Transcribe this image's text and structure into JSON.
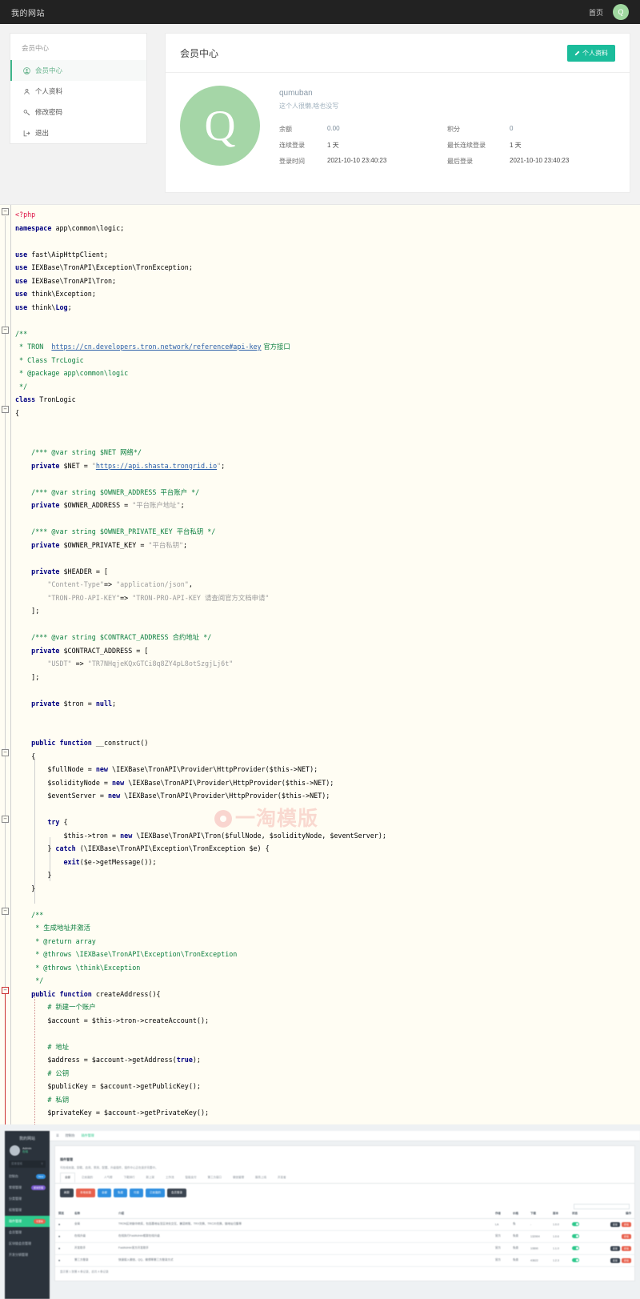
{
  "navbar": {
    "brand": "我的网站",
    "home_link": "首页",
    "avatar_letter": "Q"
  },
  "sidebar": {
    "title": "会员中心",
    "items": [
      {
        "label": "会员中心",
        "icon": "user-circle-icon",
        "active": true
      },
      {
        "label": "个人资料",
        "icon": "user-outline-icon",
        "active": false
      },
      {
        "label": "修改密码",
        "icon": "key-icon",
        "active": false
      },
      {
        "label": "退出",
        "icon": "logout-icon",
        "active": false
      }
    ]
  },
  "member_card": {
    "title": "会员中心",
    "profile_button": "个人资料",
    "avatar_letter": "Q",
    "username": "qumuban",
    "signature": "这个人很懒,啥也没写",
    "stats": [
      {
        "key": "余额",
        "value": "0.00",
        "key2": "积分",
        "value2": "0"
      },
      {
        "key": "连续登录",
        "value": "1 天",
        "key2": "最长连续登录",
        "value2": "1 天"
      },
      {
        "key": "登录时间",
        "value": "2021-10-10 23:40:23",
        "key2": "最后登录",
        "value2": "2021-10-10 23:40:23"
      }
    ]
  },
  "code": {
    "watermark": "一淘模版",
    "lines": [
      "<?php",
      "namespace app\\common\\logic;",
      "",
      "use fast\\AipHttpClient;",
      "use IEXBase\\TronAPI\\Exception\\TronException;",
      "use IEXBase\\TronAPI\\Tron;",
      "use think\\Exception;",
      "use think\\Log;",
      "",
      "/**",
      " * TRON  https://cn.developers.tron.network/reference#api-key 官方接口",
      " * Class TrcLogic",
      " * @package app\\common\\logic",
      " */",
      "class TronLogic",
      "{",
      "",
      "",
      "    /*** @var string $NET 网络*/",
      "    private $NET = \"https://api.shasta.trongrid.io\";",
      "",
      "    /*** @var string $OWNER_ADDRESS 平台账户 */",
      "    private $OWNER_ADDRESS = \"平台账户地址\";",
      "",
      "    /*** @var string $OWNER_PRIVATE_KEY 平台私钥 */",
      "    private $OWNER_PRIVATE_KEY = \"平台私钥\";",
      "",
      "    private $HEADER = [",
      "        \"Content-Type\"=> \"application/json\",",
      "        \"TRON-PRO-API-KEY\"=> \"TRON-PRO-API-KEY 请查阅官方文档申请\"",
      "    ];",
      "",
      "    /*** @var string $CONTRACT_ADDRESS 合约地址 */",
      "    private $CONTRACT_ADDRESS = [",
      "        \"USDT\" => \"TR7NHqjeKQxGTCi8q8ZY4pL8otSzgjLj6t\"",
      "    ];",
      "",
      "    private $tron = null;",
      "",
      "",
      "    public function __construct()",
      "    {",
      "        $fullNode = new \\IEXBase\\TronAPI\\Provider\\HttpProvider($this->NET);",
      "        $solidityNode = new \\IEXBase\\TronAPI\\Provider\\HttpProvider($this->NET);",
      "        $eventServer = new \\IEXBase\\TronAPI\\Provider\\HttpProvider($this->NET);",
      "",
      "        try {",
      "            $this->tron = new \\IEXBase\\TronAPI\\Tron($fullNode, $solidityNode, $eventServer);",
      "        } catch (\\IEXBase\\TronAPI\\Exception\\TronException $e) {",
      "            exit($e->getMessage());",
      "        }",
      "    }",
      "",
      "    /**",
      "     * 生成地址并激活",
      "     * @return array",
      "     * @throws \\IEXBase\\TronAPI\\Exception\\TronException",
      "     * @throws \\think\\Exception",
      "     */",
      "    public function createAddress(){",
      "        # 新建一个账户",
      "        $account = $this->tron->createAccount();",
      "",
      "        # 地址",
      "        $address = $account->getAddress(true);",
      "        # 公钥",
      "        $publicKey = $account->getPublicKey();",
      "        # 私钥",
      "        $privateKey = $account->getPrivateKey();"
    ]
  },
  "admin_shot": {
    "brand": "我的网站",
    "user_name": "Admin",
    "user_status": "在线",
    "search_placeholder": "菜单搜索",
    "menu": [
      {
        "label": "控制台",
        "badge": "New",
        "badge_color": "#2f8fe0",
        "active": false
      },
      {
        "label": "常规管理",
        "badge": "模块管理",
        "badge_color": "#7a5bd0",
        "active": false
      },
      {
        "label": "分类管理",
        "badge": "",
        "badge_color": "",
        "active": false
      },
      {
        "label": "权限管理",
        "badge": "",
        "badge_color": "",
        "active": false
      },
      {
        "label": "插件管理",
        "badge": "可更新",
        "badge_color": "#e8604c",
        "active": true
      },
      {
        "label": "会员管理",
        "badge": "",
        "badge_color": "",
        "active": false
      },
      {
        "label": "区块链会员管理",
        "badge": "",
        "badge_color": "",
        "active": false
      },
      {
        "label": "开发分销管理",
        "badge": "",
        "badge_color": "",
        "active": false
      }
    ],
    "topbar": [
      {
        "label": "控制台",
        "active": false
      },
      {
        "label": "插件管理",
        "active": true
      }
    ],
    "panel_title": "插件管理",
    "panel_desc": "可在线安装、卸载、启用、禁用、配置、升级插件，插件中心正在逐步完善中。",
    "tabs": [
      "全部",
      "已安装的",
      "人气榜",
      "下载排行",
      "新上架",
      "工作流",
      "智能支付",
      "第三方接口",
      "微信管理",
      "服务上线",
      "开发者"
    ],
    "buttons": [
      {
        "label": "刷新",
        "color": "#3a4450"
      },
      {
        "label": "本地安装",
        "color": "#e8604c"
      },
      {
        "label": "全部",
        "color": "#2f8fe0"
      },
      {
        "label": "免费",
        "color": "#2f8fe0"
      },
      {
        "label": "付费",
        "color": "#2f8fe0"
      },
      {
        "label": "已安装的",
        "color": "#2f8fe0"
      },
      {
        "label": "会员登录",
        "color": "#3a4450"
      }
    ],
    "columns": [
      "预览",
      "名称",
      "介绍",
      "作者",
      "价格",
      "下载",
      "版本",
      "状态",
      "操作"
    ],
    "rows": [
      {
        "name": "全局",
        "desc": "TRON区块链中转库，包括基地址至区块化交互、兼容转账、TRX兑换、TRC20兑换、链地址归集等",
        "author": "LA",
        "price": "免",
        "downloads": "-",
        "version": "1.0.0",
        "status": "on",
        "actions": [
          "配置",
          "卸载"
        ]
      },
      {
        "name": "在线升级",
        "desc": "在线执行FastAdmin框架在线升级",
        "author": "官方",
        "price": "免费",
        "downloads": "132904",
        "version": "1.0.6",
        "status": "on",
        "actions": [
          "卸载"
        ]
      },
      {
        "name": "开发助手",
        "desc": "FastAdmin官方开发助手",
        "author": "官方",
        "price": "免费",
        "downloads": "10890",
        "version": "1.1.0",
        "status": "on",
        "actions": [
          "配置",
          "卸载"
        ]
      },
      {
        "name": "第三方登录",
        "desc": "快速接入微信、QQ、微博等第三方登录方式",
        "author": "官方",
        "price": "免费",
        "downloads": "43622",
        "version": "1.2.3",
        "status": "on",
        "actions": [
          "配置",
          "卸载"
        ]
      }
    ],
    "search_value": "搜索",
    "footer": "显示第 1 到第 4 条记录，总共 4 条记录"
  }
}
